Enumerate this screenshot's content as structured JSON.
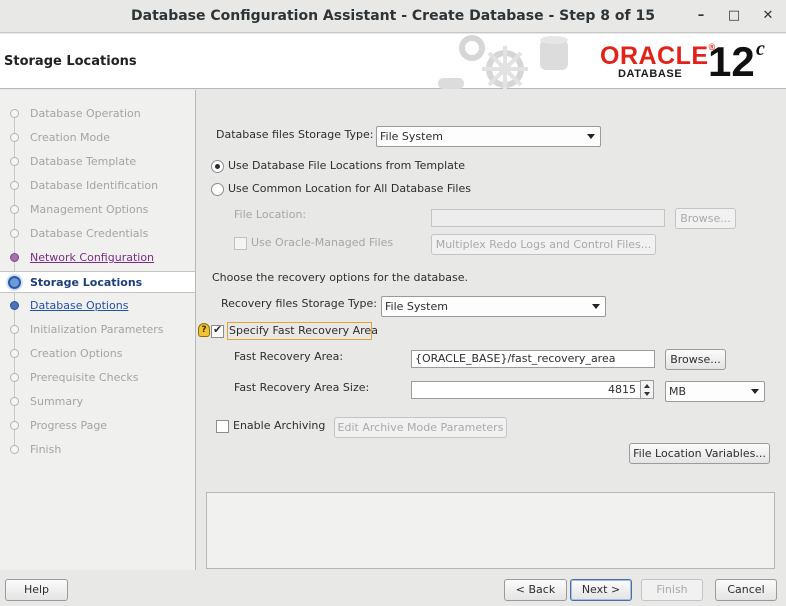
{
  "window": {
    "title": "Database Configuration Assistant - Create Database - Step 8 of 15",
    "minimize_glyph": "–",
    "maximize_glyph": "□",
    "close_glyph": "✕"
  },
  "header": {
    "page_title": "Storage Locations",
    "logo_brand": "ORACLE",
    "logo_registered": "®",
    "logo_product": "DATABASE",
    "logo_version": "12",
    "logo_version_suffix": "c"
  },
  "nav": {
    "items": [
      {
        "label": "Database Operation",
        "state": "disabled"
      },
      {
        "label": "Creation Mode",
        "state": "disabled"
      },
      {
        "label": "Database Template",
        "state": "disabled"
      },
      {
        "label": "Database Identification",
        "state": "disabled"
      },
      {
        "label": "Management Options",
        "state": "disabled"
      },
      {
        "label": "Database Credentials",
        "state": "disabled"
      },
      {
        "label": "Network Configuration",
        "state": "visited"
      },
      {
        "label": "Storage Locations",
        "state": "current"
      },
      {
        "label": "Database Options",
        "state": "link"
      },
      {
        "label": "Initialization Parameters",
        "state": "disabled"
      },
      {
        "label": "Creation Options",
        "state": "disabled"
      },
      {
        "label": "Prerequisite Checks",
        "state": "disabled"
      },
      {
        "label": "Summary",
        "state": "disabled"
      },
      {
        "label": "Progress Page",
        "state": "disabled"
      },
      {
        "label": "Finish",
        "state": "disabled"
      }
    ]
  },
  "storage": {
    "files_type_label": "Database files Storage Type:",
    "files_type_value": "File System",
    "radio_template_label": "Use Database File Locations from Template",
    "radio_template_selected": true,
    "radio_common_label": "Use Common Location for All Database Files",
    "radio_common_selected": false,
    "file_location_label": "File Location:",
    "file_location_value": "",
    "browse_label": "Browse...",
    "omf_label": "Use Oracle-Managed Files",
    "omf_checked": false,
    "multiplex_label": "Multiplex Redo Logs and Control Files..."
  },
  "recovery": {
    "intro": "Choose the recovery options for the database.",
    "type_label": "Recovery files Storage Type:",
    "type_value": "File System",
    "hint_icon": "?",
    "sfra_label": "Specify Fast Recovery Area",
    "sfra_checked": true,
    "fra_label": "Fast Recovery Area:",
    "fra_value": "{ORACLE_BASE}/fast_recovery_area",
    "fra_browse": "Browse...",
    "size_label": "Fast Recovery Area Size:",
    "size_value": "4815",
    "size_unit": "MB",
    "archiving_label": "Enable Archiving",
    "archiving_checked": false,
    "edit_archive_label": "Edit Archive Mode Parameters",
    "file_loc_vars_label": "File Location Variables...",
    "message_text": ""
  },
  "footer": {
    "help": "Help",
    "back": "< Back",
    "next": "Next >",
    "finish": "Finish",
    "cancel": "Cancel"
  },
  "colors": {
    "oracle_red": "#e2231a",
    "link_blue": "#2053a8",
    "visited_purple": "#7b2c86",
    "current_bg": "#ffffff",
    "disabled_text": "#a4a4a4"
  }
}
